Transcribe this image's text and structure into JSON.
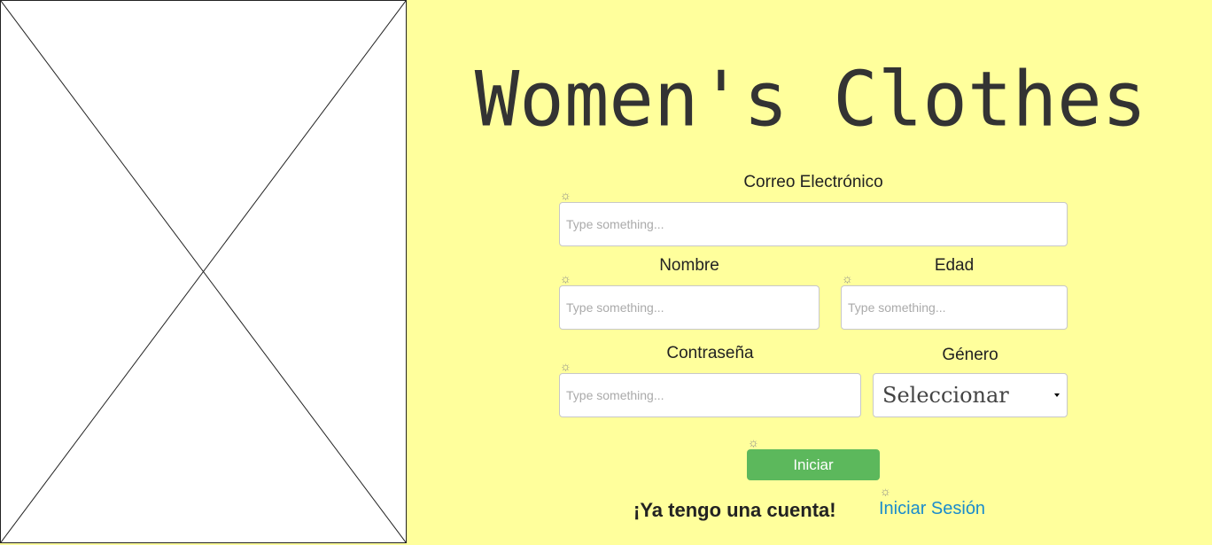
{
  "form": {
    "title": "Women's Clothes",
    "email": {
      "label": "Correo Electrónico",
      "placeholder": "Type something..."
    },
    "name": {
      "label": "Nombre",
      "placeholder": "Type something..."
    },
    "age": {
      "label": "Edad",
      "placeholder": "Type something..."
    },
    "password": {
      "label": "Contraseña",
      "placeholder": "Type something..."
    },
    "gender": {
      "label": "Género",
      "selected": "Seleccionar"
    },
    "submit_label": "Iniciar",
    "have_account_text": "¡Ya tengo una cuenta!",
    "login_link": "Iniciar Sesión"
  },
  "icons": {
    "field_marker": "gear-icon",
    "image_placeholder": "image-placeholder-icon"
  },
  "colors": {
    "background": "#ffff9c",
    "button": "#5cb85c",
    "link": "#1a8ccc"
  }
}
